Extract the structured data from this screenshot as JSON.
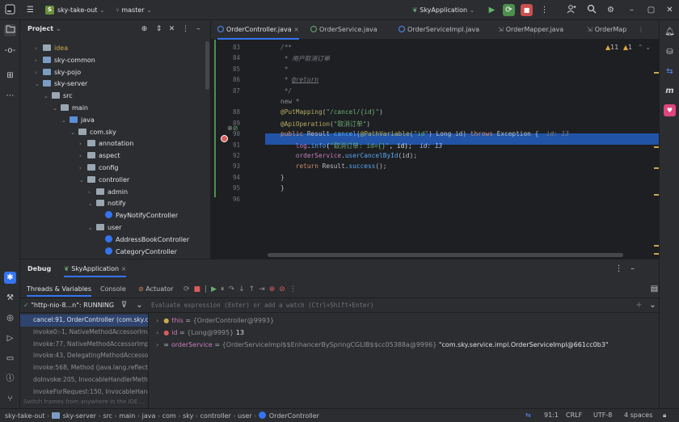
{
  "titlebar": {
    "project": "sky-take-out",
    "project_badge": "S",
    "branch": "master",
    "run_config": "SkyApplication"
  },
  "project_panel": {
    "title": "Project",
    "tree": [
      {
        "label": "idea",
        "indent": 0,
        "arrow": "›",
        "kind": "folder"
      },
      {
        "label": "sky-common",
        "indent": 0,
        "arrow": "›",
        "kind": "module"
      },
      {
        "label": "sky-pojo",
        "indent": 0,
        "arrow": "›",
        "kind": "module"
      },
      {
        "label": "sky-server",
        "indent": 0,
        "arrow": "⌄",
        "kind": "module"
      },
      {
        "label": "src",
        "indent": 1,
        "arrow": "⌄",
        "kind": "folder"
      },
      {
        "label": "main",
        "indent": 2,
        "arrow": "⌄",
        "kind": "folder"
      },
      {
        "label": "java",
        "indent": 3,
        "arrow": "⌄",
        "kind": "src"
      },
      {
        "label": "com.sky",
        "indent": 4,
        "arrow": "⌄",
        "kind": "folder"
      },
      {
        "label": "annotation",
        "indent": 5,
        "arrow": "›",
        "kind": "folder"
      },
      {
        "label": "aspect",
        "indent": 5,
        "arrow": "›",
        "kind": "folder"
      },
      {
        "label": "config",
        "indent": 5,
        "arrow": "›",
        "kind": "folder"
      },
      {
        "label": "controller",
        "indent": 5,
        "arrow": "⌄",
        "kind": "folder"
      },
      {
        "label": "admin",
        "indent": 6,
        "arrow": "›",
        "kind": "folder"
      },
      {
        "label": "notify",
        "indent": 6,
        "arrow": "⌄",
        "kind": "folder"
      },
      {
        "label": "PayNotifyController",
        "indent": 7,
        "arrow": "",
        "kind": "class"
      },
      {
        "label": "user",
        "indent": 6,
        "arrow": "⌄",
        "kind": "folder"
      },
      {
        "label": "AddressBookController",
        "indent": 7,
        "arrow": "",
        "kind": "class"
      },
      {
        "label": "CategoryController",
        "indent": 7,
        "arrow": "",
        "kind": "class"
      }
    ]
  },
  "editor": {
    "tabs": [
      {
        "label": "OrderController.java",
        "active": true,
        "closable": "×"
      },
      {
        "label": "OrderService.java",
        "active": false,
        "closable": ""
      },
      {
        "label": "OrderServiceImpl.java",
        "active": false,
        "closable": ""
      },
      {
        "label": "OrderMapper.java",
        "active": false,
        "closable": ""
      },
      {
        "label": "OrderMap",
        "active": false,
        "closable": ""
      }
    ],
    "inspections": {
      "warnings": "11",
      "weak_warnings": "1"
    },
    "line_numbers": [
      "83",
      "84",
      "85",
      "86",
      "87",
      "",
      "88",
      "89",
      "90",
      "91",
      "92",
      "93",
      "94",
      "95",
      "96"
    ],
    "lines": [
      "/**",
      " * 用户取消订单",
      " *",
      " * @return",
      " */",
      "new *",
      "@PutMapping(\"/cancel/{id}\")",
      "@ApiOperation(\"取消订单\")",
      "public Result cancel(@PathVariable(\"id\") Long id) throws Exception {",
      "    log.info(\"取消订单: id={}\", id);",
      "    orderService.userCancelById(id);",
      "    return Result.success();",
      "}",
      "}",
      ""
    ],
    "inline_hint_90": "id: 13",
    "inline_hint_91": "id: 13"
  },
  "debug": {
    "title": "Debug",
    "session": "SkyApplication",
    "tabs": [
      "Threads & Variables",
      "Console",
      "Actuator"
    ],
    "thread": "\"http-nio-8...n\": RUNNING",
    "eval_placeholder": "Evaluate expression (Enter) or add a watch (Ctrl+Shift+Enter)",
    "frames": [
      "cancel:91, OrderController (com.sky.c",
      "invoke0:-1, NativeMethodAccessorImpl",
      "invoke:77, NativeMethodAccessorImp",
      "invoke:43, DelegatingMethodAccesso",
      "invoke:568, Method (java.lang.reflect",
      "doInvoke:205, InvocableHandlerMetho",
      "invokeForRequest:150, InvocableHand"
    ],
    "frames_hint": "Switch frames from anywhere in the IDE ...",
    "variables": [
      {
        "name": "this",
        "eq": " = ",
        "type": "{OrderController@9993}",
        "value": ""
      },
      {
        "name": "id",
        "eq": " = ",
        "type": "{Long@9995}",
        "value": " 13"
      },
      {
        "name": "orderService",
        "eq": " = ",
        "type": "{OrderServiceImpl$$EnhancerBySpringCGLIB$$cc05388a@9996}",
        "value": " \"com.sky.service.impl.OrderServiceImpl@661cc0b3\""
      }
    ]
  },
  "statusbar": {
    "breadcrumb": [
      "sky-take-out",
      "sky-server",
      "src",
      "main",
      "java",
      "com",
      "sky",
      "controller",
      "user",
      "OrderController"
    ],
    "position": "91:1",
    "line_sep": "CRLF",
    "encoding": "UTF-8",
    "indent": "4 spaces"
  }
}
